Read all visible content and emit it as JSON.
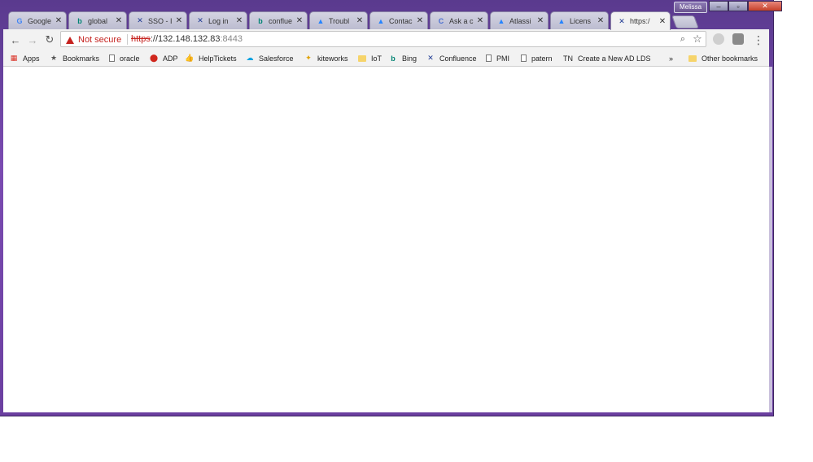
{
  "window": {
    "profile_name": "Melissa",
    "controls": {
      "minimize": "–",
      "maximize": "▫",
      "close": "✕"
    }
  },
  "tabs": [
    {
      "label": "Google",
      "icon": "G",
      "icon_color": "#4285f4",
      "close": "✕"
    },
    {
      "label": "global",
      "icon": "b",
      "icon_color": "#008373",
      "close": "✕"
    },
    {
      "label": "SSO - I",
      "icon": "✕",
      "icon_color": "#1f3a93",
      "close": "✕"
    },
    {
      "label": "Log in",
      "icon": "✕",
      "icon_color": "#1f3a93",
      "close": "✕"
    },
    {
      "label": "conflue",
      "icon": "b",
      "icon_color": "#008373",
      "close": "✕"
    },
    {
      "label": "Troubl",
      "icon": "▲",
      "icon_color": "#2684ff",
      "close": "✕"
    },
    {
      "label": "Contac",
      "icon": "▲",
      "icon_color": "#2684ff",
      "close": "✕"
    },
    {
      "label": "Ask a c",
      "icon": "C",
      "icon_color": "#4a6fd1",
      "close": "✕"
    },
    {
      "label": "Atlassi",
      "icon": "▲",
      "icon_color": "#2684ff",
      "close": "✕"
    },
    {
      "label": "Licens",
      "icon": "▲",
      "icon_color": "#2684ff",
      "close": "✕"
    },
    {
      "label": "https:/",
      "icon": "✕",
      "icon_color": "#1f3a93",
      "close": "✕",
      "active": true
    }
  ],
  "toolbar": {
    "back": "←",
    "forward": "→",
    "reload": "↻",
    "security_label": "Not secure",
    "url_scheme": "https",
    "url_host": "://132.148.132.83",
    "url_port": ":8443",
    "zoom_icon": "⌕",
    "star_icon": "☆",
    "menu_icon": "⋮"
  },
  "bookmarks": {
    "items": [
      {
        "label": "Apps",
        "icon": "apps-grid"
      },
      {
        "label": "Bookmarks",
        "icon": "star"
      },
      {
        "label": "oracle",
        "icon": "page"
      },
      {
        "label": "ADP",
        "icon": "adp"
      },
      {
        "label": "HelpTickets",
        "icon": "thumb"
      },
      {
        "label": "Salesforce",
        "icon": "cloud"
      },
      {
        "label": "kiteworks",
        "icon": "kite"
      },
      {
        "label": "IoT",
        "icon": "folder"
      },
      {
        "label": "Bing",
        "icon": "bing"
      },
      {
        "label": "Confluence",
        "icon": "confluence"
      },
      {
        "label": "PMI",
        "icon": "page"
      },
      {
        "label": "patern",
        "icon": "page"
      },
      {
        "label": "TN",
        "icon": "text"
      },
      {
        "label": "Create a New AD LDS",
        "icon": "none"
      }
    ],
    "overflow": "»",
    "other_label": "Other bookmarks"
  }
}
